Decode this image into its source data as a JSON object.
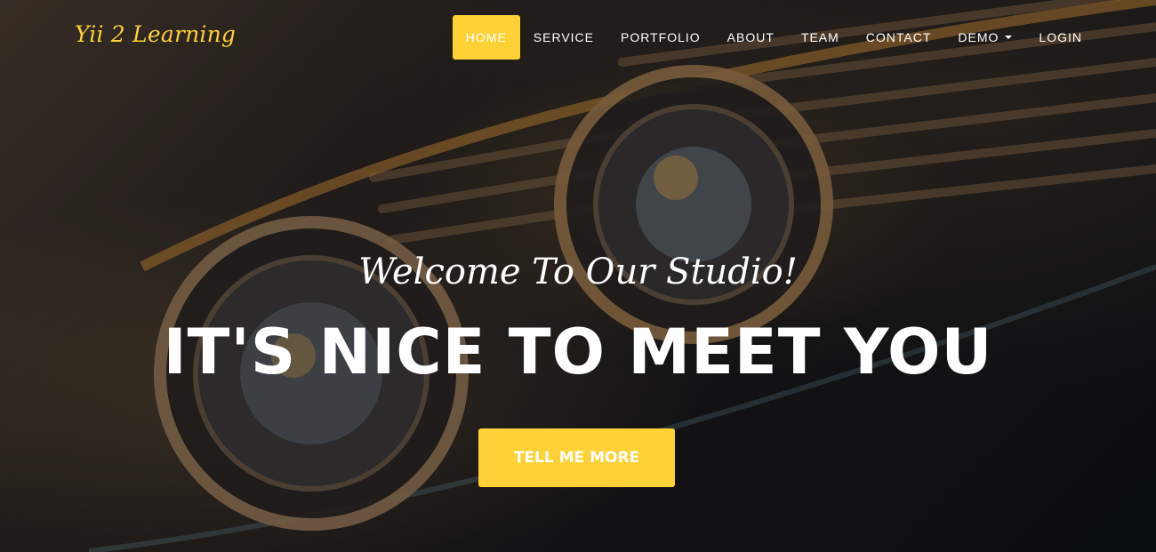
{
  "brand": {
    "name": "Yii 2 Learning",
    "color": "#fed136"
  },
  "nav": {
    "items": [
      {
        "label": "HOME",
        "active": true
      },
      {
        "label": "SERVICE",
        "active": false
      },
      {
        "label": "PORTFOLIO",
        "active": false
      },
      {
        "label": "ABOUT",
        "active": false
      },
      {
        "label": "TEAM",
        "active": false
      },
      {
        "label": "CONTACT",
        "active": false
      },
      {
        "label": "DEMO",
        "active": false,
        "dropdown": true,
        "icon": "caret-down-icon"
      },
      {
        "label": "LOGIN",
        "active": false
      }
    ]
  },
  "hero": {
    "lead": "Welcome To Our Studio!",
    "heading": "IT'S NICE TO MEET YOU",
    "cta_label": "TELL ME MORE",
    "accent_color": "#fed136",
    "background": "vintage car headlights and chrome grille"
  }
}
